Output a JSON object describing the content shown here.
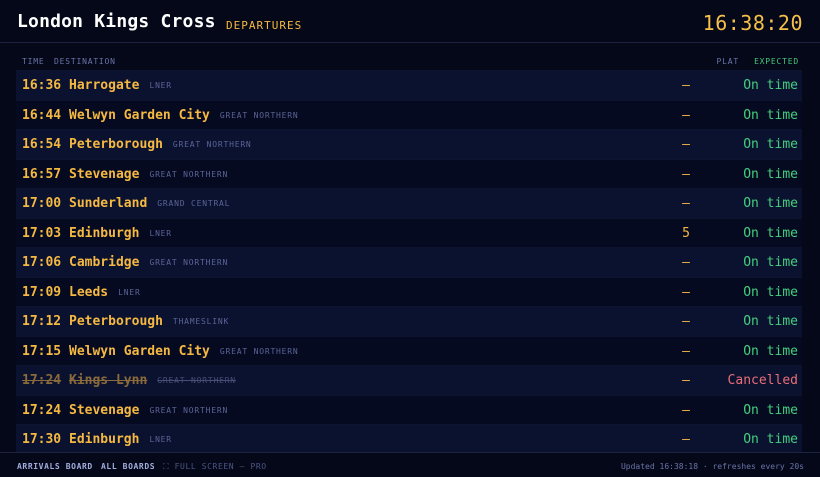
{
  "header": {
    "station": "London Kings Cross",
    "board_type": "DEPARTURES",
    "clock": "16:38:20"
  },
  "columns": {
    "time": "TIME",
    "destination": "DESTINATION",
    "platform": "PLAT",
    "expected": "EXPECTED"
  },
  "rows": [
    {
      "time": "16:36",
      "destination": "Harrogate",
      "operator": "LNER",
      "platform": "—",
      "expected": "On time"
    },
    {
      "time": "16:44",
      "destination": "Welwyn Garden City",
      "operator": "GREAT NORTHERN",
      "platform": "—",
      "expected": "On time"
    },
    {
      "time": "16:54",
      "destination": "Peterborough",
      "operator": "GREAT NORTHERN",
      "platform": "—",
      "expected": "On time"
    },
    {
      "time": "16:57",
      "destination": "Stevenage",
      "operator": "GREAT NORTHERN",
      "platform": "—",
      "expected": "On time"
    },
    {
      "time": "17:00",
      "destination": "Sunderland",
      "operator": "GRAND CENTRAL",
      "platform": "—",
      "expected": "On time"
    },
    {
      "time": "17:03",
      "destination": "Edinburgh",
      "operator": "LNER",
      "platform": "5",
      "expected": "On time"
    },
    {
      "time": "17:06",
      "destination": "Cambridge",
      "operator": "GREAT NORTHERN",
      "platform": "—",
      "expected": "On time"
    },
    {
      "time": "17:09",
      "destination": "Leeds",
      "operator": "LNER",
      "platform": "—",
      "expected": "On time"
    },
    {
      "time": "17:12",
      "destination": "Peterborough",
      "operator": "THAMESLINK",
      "platform": "—",
      "expected": "On time"
    },
    {
      "time": "17:15",
      "destination": "Welwyn Garden City",
      "operator": "GREAT NORTHERN",
      "platform": "—",
      "expected": "On time"
    },
    {
      "time": "17:24",
      "destination": "Kings Lynn",
      "operator": "GREAT NORTHERN",
      "platform": "—",
      "expected": "Cancelled",
      "cancelled": true
    },
    {
      "time": "17:24",
      "destination": "Stevenage",
      "operator": "GREAT NORTHERN",
      "platform": "—",
      "expected": "On time"
    },
    {
      "time": "17:30",
      "destination": "Edinburgh",
      "operator": "LNER",
      "platform": "—",
      "expected": "On time"
    }
  ],
  "footer": {
    "arrivals_link": "ARRIVALS BOARD",
    "all_boards_link": "ALL BOARDS",
    "fullscreen": "⛶ FULL SCREEN — PRO",
    "updated": "Updated 16:38:18 · refreshes every 20s"
  },
  "colors": {
    "background": "#050818",
    "amber": "#f5b942",
    "on_time": "#43d07e",
    "cancelled": "#ea6d77"
  }
}
